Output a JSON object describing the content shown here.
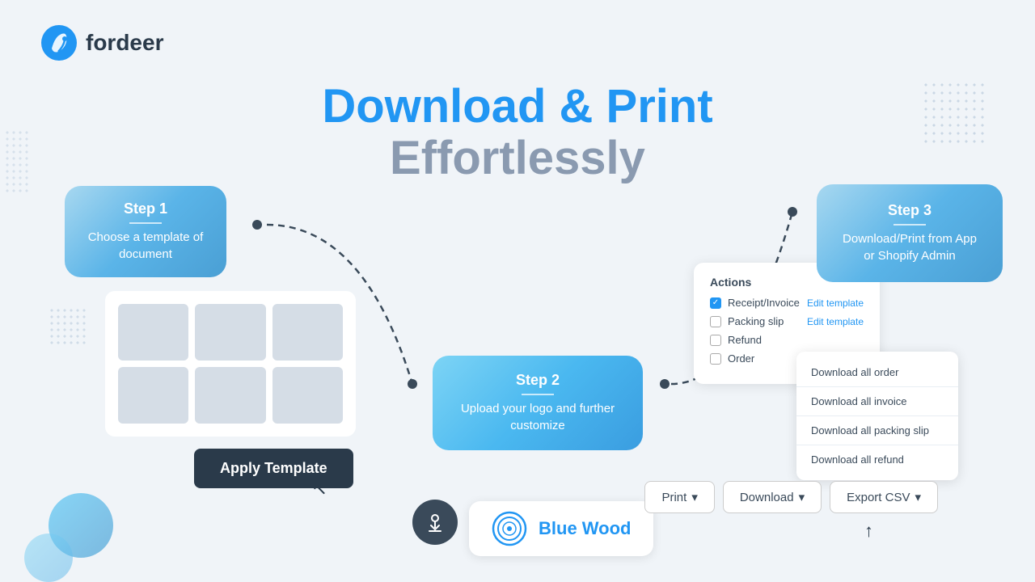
{
  "logo": {
    "text": "fordeer"
  },
  "title": {
    "line1": "Download & Print",
    "line2": "Effortlessly"
  },
  "step1": {
    "label": "Step 1",
    "description": "Choose a template of document"
  },
  "apply_button": "Apply Template",
  "step2": {
    "label": "Step 2",
    "description": "Upload your logo and further customize"
  },
  "step3": {
    "label": "Step 3",
    "description": "Download/Print from App or Shopify Admin"
  },
  "actions": {
    "title": "Actions",
    "items": [
      {
        "label": "Receipt/Invoice",
        "checked": true,
        "edit": "Edit template"
      },
      {
        "label": "Packing slip",
        "checked": false,
        "edit": "Edit template"
      },
      {
        "label": "Refund",
        "checked": false,
        "edit": ""
      },
      {
        "label": "Order",
        "checked": false,
        "edit": ""
      }
    ]
  },
  "dropdown": {
    "items": [
      "Download all order",
      "Download all invoice",
      "Download all packing slip",
      "Download all refund"
    ]
  },
  "buttons": {
    "print": "Print",
    "download": "Download",
    "export_csv": "Export CSV"
  },
  "bluewood": {
    "text": "Blue Wood"
  }
}
